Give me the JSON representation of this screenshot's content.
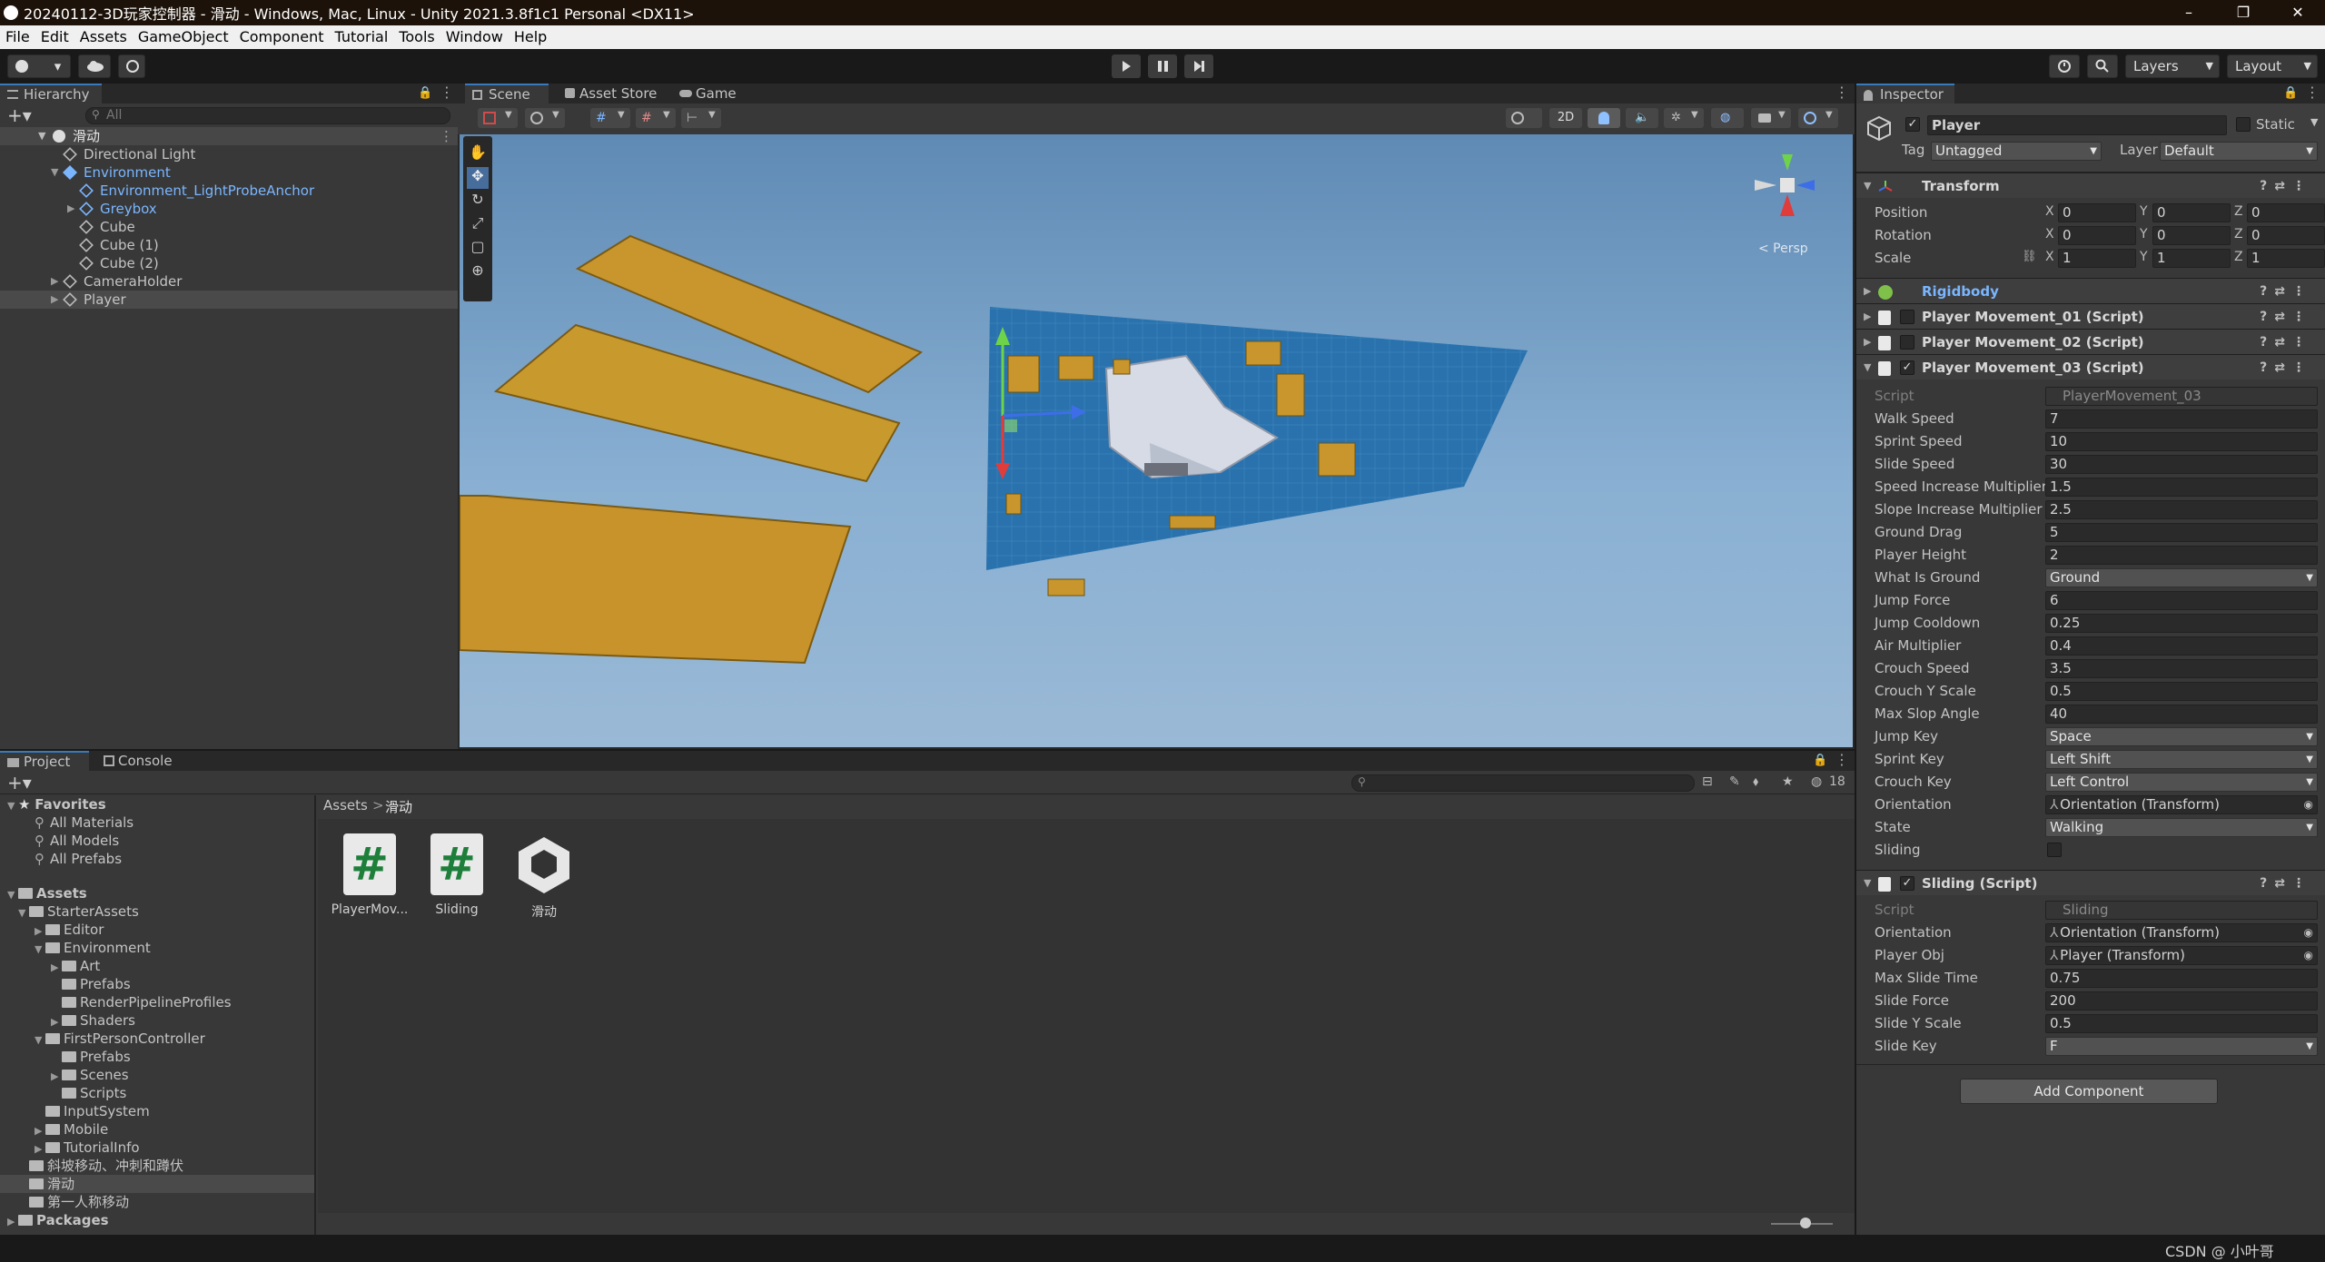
{
  "window": {
    "title": "20240112-3D玩家控制器 - 滑动 - Windows, Mac, Linux - Unity 2021.3.8f1c1 Personal <DX11>",
    "minimize": "–",
    "maximize": "❐",
    "close": "✕"
  },
  "menu": [
    "File",
    "Edit",
    "Assets",
    "GameObject",
    "Component",
    "Tutorial",
    "Tools",
    "Window",
    "Help"
  ],
  "toolbar": {
    "account_caret": "▾",
    "layers_label": "Layers",
    "layout_label": "Layout"
  },
  "hierarchy": {
    "tab_label": "Hierarchy",
    "search_placeholder": "All",
    "scene_name": "滑动",
    "items": [
      {
        "label": "Directional Light",
        "depth": 1,
        "prefab": false
      },
      {
        "label": "Environment",
        "depth": 1,
        "prefab": true
      },
      {
        "label": "Environment_LightProbeAnchor",
        "depth": 2,
        "prefab": true
      },
      {
        "label": "Greybox",
        "depth": 2,
        "prefab": true
      },
      {
        "label": "Cube",
        "depth": 2,
        "prefab": false
      },
      {
        "label": "Cube (1)",
        "depth": 2,
        "prefab": false
      },
      {
        "label": "Cube (2)",
        "depth": 2,
        "prefab": false
      },
      {
        "label": "CameraHolder",
        "depth": 1,
        "prefab": false
      },
      {
        "label": "Player",
        "depth": 1,
        "prefab": false
      }
    ]
  },
  "scene": {
    "tabs": [
      "Scene",
      "Asset Store",
      "Game"
    ],
    "btn_2d": "2D",
    "persp_label": "< Persp"
  },
  "inspector": {
    "tab_label": "Inspector",
    "object_name": "Player",
    "static_label": "Static",
    "tag_label": "Tag",
    "tag_value": "Untagged",
    "layer_label": "Layer",
    "layer_value": "Default",
    "transform": {
      "title": "Transform",
      "rows": [
        {
          "label": "Position",
          "x": "0",
          "y": "0",
          "z": "0"
        },
        {
          "label": "Rotation",
          "x": "0",
          "y": "0",
          "z": "0"
        },
        {
          "label": "Scale",
          "x": "1",
          "y": "1",
          "z": "1"
        }
      ]
    },
    "rigidbody_title": "Rigidbody",
    "pm1_title": "Player Movement_01 (Script)",
    "pm2_title": "Player Movement_02 (Script)",
    "pm3": {
      "title": "Player Movement_03 (Script)",
      "script_label": "Script",
      "script_value": "PlayerMovement_03",
      "props": [
        {
          "label": "Walk Speed",
          "value": "7",
          "type": "num"
        },
        {
          "label": "Sprint Speed",
          "value": "10",
          "type": "num"
        },
        {
          "label": "Slide Speed",
          "value": "30",
          "type": "num"
        },
        {
          "label": "Speed Increase Multiplier",
          "value": "1.5",
          "type": "num"
        },
        {
          "label": "Slope Increase Multiplier",
          "value": "2.5",
          "type": "num"
        },
        {
          "label": "Ground Drag",
          "value": "5",
          "type": "num"
        },
        {
          "label": "Player Height",
          "value": "2",
          "type": "num"
        },
        {
          "label": "What Is Ground",
          "value": "Ground",
          "type": "dd"
        },
        {
          "label": "Jump Force",
          "value": "6",
          "type": "num"
        },
        {
          "label": "Jump Cooldown",
          "value": "0.25",
          "type": "num"
        },
        {
          "label": "Air Multiplier",
          "value": "0.4",
          "type": "num"
        },
        {
          "label": "Crouch Speed",
          "value": "3.5",
          "type": "num"
        },
        {
          "label": "Crouch Y Scale",
          "value": "0.5",
          "type": "num"
        },
        {
          "label": "Max Slop Angle",
          "value": "40",
          "type": "num"
        },
        {
          "label": "Jump Key",
          "value": "Space",
          "type": "dd"
        },
        {
          "label": "Sprint Key",
          "value": "Left Shift",
          "type": "dd"
        },
        {
          "label": "Crouch Key",
          "value": "Left Control",
          "type": "dd"
        },
        {
          "label": "Orientation",
          "value": "Orientation (Transform)",
          "type": "obj"
        },
        {
          "label": "State",
          "value": "Walking",
          "type": "dd"
        },
        {
          "label": "Sliding",
          "value": "",
          "type": "chk"
        }
      ]
    },
    "sliding": {
      "title": "Sliding (Script)",
      "script_label": "Script",
      "script_value": "Sliding",
      "props": [
        {
          "label": "Orientation",
          "value": "Orientation (Transform)",
          "type": "obj"
        },
        {
          "label": "Player Obj",
          "value": "Player (Transform)",
          "type": "obj"
        },
        {
          "label": "Max Slide Time",
          "value": "0.75",
          "type": "num"
        },
        {
          "label": "Slide Force",
          "value": "200",
          "type": "num"
        },
        {
          "label": "Slide Y Scale",
          "value": "0.5",
          "type": "num"
        },
        {
          "label": "Slide Key",
          "value": "F",
          "type": "dd"
        }
      ]
    },
    "add_component": "Add Component"
  },
  "project": {
    "tabs": [
      "Project",
      "Console"
    ],
    "hidden_count": "18",
    "breadcrumb_root": "Assets",
    "breadcrumb_sep": ">",
    "breadcrumb_current": "滑动",
    "favorites_label": "Favorites",
    "favorites": [
      "All Materials",
      "All Models",
      "All Prefabs"
    ],
    "assets_label": "Assets",
    "tree": [
      {
        "label": "StarterAssets",
        "depth": 1,
        "open": true
      },
      {
        "label": "Editor",
        "depth": 2,
        "open": false
      },
      {
        "label": "Environment",
        "depth": 2,
        "open": true
      },
      {
        "label": "Art",
        "depth": 3,
        "open": false
      },
      {
        "label": "Prefabs",
        "depth": 3,
        "open": null
      },
      {
        "label": "RenderPipelineProfiles",
        "depth": 3,
        "open": null
      },
      {
        "label": "Shaders",
        "depth": 3,
        "open": false
      },
      {
        "label": "FirstPersonController",
        "depth": 2,
        "open": true
      },
      {
        "label": "Prefabs",
        "depth": 3,
        "open": null
      },
      {
        "label": "Scenes",
        "depth": 3,
        "open": false
      },
      {
        "label": "Scripts",
        "depth": 3,
        "open": null
      },
      {
        "label": "InputSystem",
        "depth": 2,
        "open": null
      },
      {
        "label": "Mobile",
        "depth": 2,
        "open": false
      },
      {
        "label": "TutorialInfo",
        "depth": 2,
        "open": false
      },
      {
        "label": "斜坡移动、冲刺和蹲伏",
        "depth": 1,
        "open": null
      },
      {
        "label": "滑动",
        "depth": 1,
        "open": null
      },
      {
        "label": "第一人称移动",
        "depth": 1,
        "open": null
      }
    ],
    "packages_label": "Packages",
    "assets": [
      {
        "label": "PlayerMov...",
        "kind": "script"
      },
      {
        "label": "Sliding",
        "kind": "script"
      },
      {
        "label": "滑动",
        "kind": "scene"
      }
    ]
  },
  "status": {
    "watermark": "CSDN @ 小叶哥"
  },
  "colors": {
    "accent": "#3a79bb",
    "sky": "#7ea7cc",
    "ground": "#1e6aa6",
    "ramp": "#c8962c",
    "blue_text": "#7ab6ff"
  }
}
